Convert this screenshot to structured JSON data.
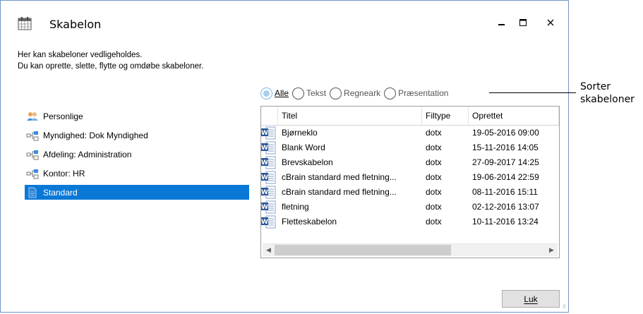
{
  "window": {
    "title": "Skabelon",
    "minimize_label": "–",
    "maximize_label": "☐",
    "close_label": "✕"
  },
  "intro": {
    "line1": "Her kan skabeloner vedligeholdes.",
    "line2": "Du kan oprette, slette, flytte og omdøbe skabeloner."
  },
  "filter": {
    "options": [
      {
        "label": "Alle",
        "checked": true
      },
      {
        "label": "Tekst",
        "checked": false
      },
      {
        "label": "Regneark",
        "checked": false
      },
      {
        "label": "Præsentation",
        "checked": false
      }
    ]
  },
  "callout": {
    "line1": "Sorter",
    "line2": "skabeloner"
  },
  "tree": {
    "items": [
      {
        "label": "Personlige",
        "icon": "users-icon"
      },
      {
        "label": "Myndighed: Dok Myndighed",
        "icon": "org-node-icon"
      },
      {
        "label": "Afdeling: Administration",
        "icon": "org-node-icon"
      },
      {
        "label": "Kontor: HR",
        "icon": "org-node-icon"
      },
      {
        "label": "Standard",
        "icon": "document-icon",
        "selected": true
      }
    ]
  },
  "table": {
    "columns": [
      "Titel",
      "Filtype",
      "Oprettet"
    ],
    "rows": [
      {
        "title": "Bjørneklo",
        "type": "dotx",
        "created": "19-05-2016 09:00"
      },
      {
        "title": "Blank Word",
        "type": "dotx",
        "created": "15-11-2016 14:05"
      },
      {
        "title": "Brevskabelon",
        "type": "dotx",
        "created": "27-09-2017 14:25"
      },
      {
        "title": "cBrain standard med fletning...",
        "type": "dotx",
        "created": "19-06-2014 22:59"
      },
      {
        "title": "cBrain standard med fletning...",
        "type": "dotx",
        "created": "08-11-2016 15:11"
      },
      {
        "title": "fletning",
        "type": "dotx",
        "created": "02-12-2016 13:07"
      },
      {
        "title": "Fletteskabelon",
        "type": "dotx",
        "created": "10-11-2016 13:24"
      }
    ],
    "scroll_left": "◀",
    "scroll_right": "▶"
  },
  "buttons": {
    "close_label": "Luk"
  },
  "colors": {
    "selection": "#0a78d7",
    "word_blue": "#2b579a",
    "window_border": "#6f93c4"
  }
}
